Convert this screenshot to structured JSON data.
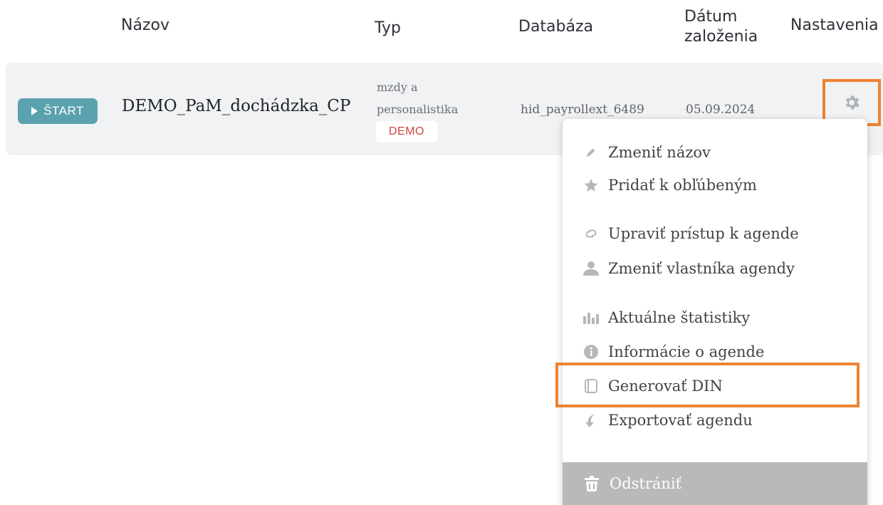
{
  "table": {
    "headers": {
      "name": "Názov",
      "type": "Typ",
      "database": "Databáza",
      "created_line1": "Dátum",
      "created_line2": "založenia",
      "settings": "Nastavenia"
    },
    "row": {
      "start_label": "ŠTART",
      "name": "DEMO_PaM_dochádzka_CP",
      "type_line1": "mzdy a",
      "type_line2": "personalistika",
      "badge": "DEMO",
      "database": "hid_payrollext_6489",
      "created": "05.09.2024"
    }
  },
  "settings_menu": {
    "items": [
      {
        "label": "Zmeniť názov",
        "icon": "pencil-icon"
      },
      {
        "label": "Pridať k obľúbeným",
        "icon": "star-icon"
      },
      {
        "label": "Upraviť prístup k agende",
        "icon": "link-icon"
      },
      {
        "label": "Zmeniť vlastníka agendy",
        "icon": "user-icon"
      },
      {
        "label": "Aktuálne štatistiky",
        "icon": "bar-chart-icon"
      },
      {
        "label": "Informácie o agende",
        "icon": "info-icon"
      },
      {
        "label": "Generovať DIN",
        "icon": "document-icon"
      },
      {
        "label": "Exportovať agendu",
        "icon": "export-icon"
      }
    ],
    "delete_label": "Odstrániť",
    "highlighted_item": "Generovať DIN"
  },
  "colors": {
    "accent": "#5aa2ae",
    "highlight": "#ee8232",
    "badge_text": "#d0453b",
    "row_bg": "#f1f2f3",
    "delete_bg": "#b9b9b9"
  }
}
